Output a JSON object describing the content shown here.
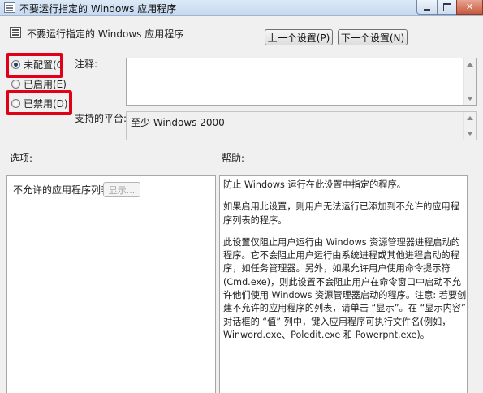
{
  "window": {
    "title": "不要运行指定的 Windows 应用程序"
  },
  "header": {
    "title": "不要运行指定的 Windows 应用程序",
    "prev_label": "上一个设置(P)",
    "next_label": "下一个设置(N)"
  },
  "state": {
    "options": [
      {
        "label": "未配置(C",
        "checked": true
      },
      {
        "label": "已启用(E)",
        "checked": false
      },
      {
        "label": "已禁用(D)",
        "checked": false
      }
    ],
    "highlight_color": "#e00018"
  },
  "fields": {
    "comment_label": "注释:",
    "platform_label": "支持的平台:",
    "platform_value": "至少 Windows 2000"
  },
  "sections": {
    "options_label": "选项:",
    "help_label": "帮助:"
  },
  "options_panel": {
    "list_label": "不允许的应用程序列表",
    "show_button": "显示..."
  },
  "help": {
    "paragraphs": [
      "防止 Windows 运行在此设置中指定的程序。",
      "如果启用此设置，则用户无法运行已添加到不允许的应用程序列表的程序。",
      "此设置仅阻止用户运行由 Windows 资源管理器进程启动的程序。它不会阻止用户运行由系统进程或其他进程启动的程序，如任务管理器。另外，如果允许用户使用命令提示符(Cmd.exe)，则此设置不会阻止用户在命令窗口中启动不允许他们使用 Windows 资源管理器启动的程序。注意: 若要创建不允许的应用程序的列表，请单击 “显示”。在 “显示内容” 对话框的 “值” 列中，键入应用程序可执行文件名(例如，Winword.exe、Poledit.exe 和 Powerpnt.exe)。"
    ]
  }
}
